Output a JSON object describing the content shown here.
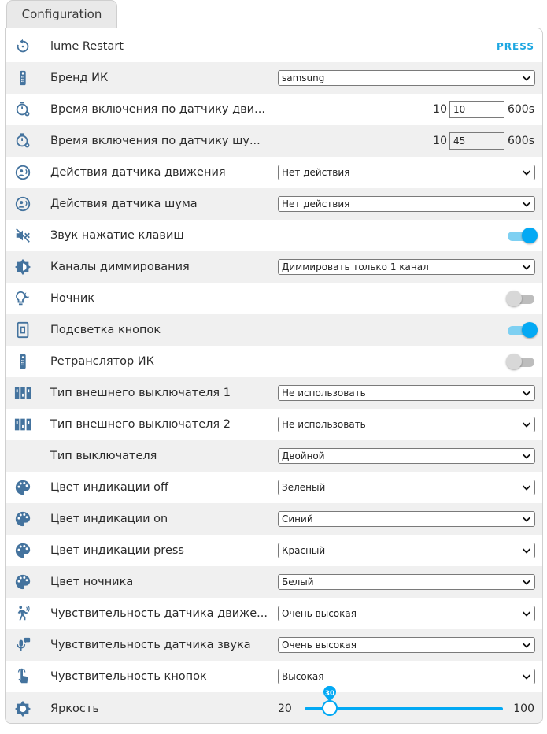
{
  "tab": {
    "label": "Configuration"
  },
  "colors": {
    "accent": "#03a9f4",
    "icon": "#44739e",
    "stripe": "#f0f0f0"
  },
  "rows": [
    {
      "icon": "restart-icon",
      "label": "lume Restart",
      "control": "press",
      "action": "PRESS"
    },
    {
      "icon": "remote-icon",
      "label": "Бренд ИК",
      "control": "select",
      "value": "samsung"
    },
    {
      "icon": "timer-cog-icon",
      "label": "Время включения по датчику дви...",
      "control": "number",
      "min": "10",
      "value": "10",
      "max": "600s"
    },
    {
      "icon": "timer-cog-icon",
      "label": "Время включения по датчику шу...",
      "control": "number",
      "min": "10",
      "value": "45",
      "max": "600s"
    },
    {
      "icon": "motion-sensor-icon",
      "label": "Действия датчика движения",
      "control": "select",
      "value": "Нет действия"
    },
    {
      "icon": "motion-sensor-icon",
      "label": "Действия датчика шума",
      "control": "select",
      "value": "Нет действия"
    },
    {
      "icon": "volume-off-icon",
      "label": "Звук нажатие клавиш",
      "control": "toggle",
      "on": true
    },
    {
      "icon": "brightness-icon",
      "label": "Каналы диммирования",
      "control": "select",
      "value": "Диммировать только 1 канал"
    },
    {
      "icon": "night-light-icon",
      "label": "Ночник",
      "control": "toggle",
      "on": false
    },
    {
      "icon": "light-switch-icon",
      "label": "Подсветка кнопок",
      "control": "toggle",
      "on": true
    },
    {
      "icon": "remote-icon",
      "label": "Ретранслятор ИК",
      "control": "toggle",
      "on": false
    },
    {
      "icon": "switch-panel-icon",
      "label": "Тип внешнего выключателя 1",
      "control": "select",
      "value": "Не использовать"
    },
    {
      "icon": "switch-panel-icon",
      "label": "Тип внешнего выключателя 2",
      "control": "select",
      "value": "Не использовать"
    },
    {
      "icon": "",
      "label": "Тип выключателя",
      "control": "select",
      "value": "Двойной"
    },
    {
      "icon": "palette-icon",
      "label": "Цвет индикации off",
      "control": "select",
      "value": "Зеленый"
    },
    {
      "icon": "palette-icon",
      "label": "Цвет индикации on",
      "control": "select",
      "value": "Синий"
    },
    {
      "icon": "palette-icon",
      "label": "Цвет индикации press",
      "control": "select",
      "value": "Красный"
    },
    {
      "icon": "palette-icon",
      "label": "Цвет ночника",
      "control": "select",
      "value": "Белый"
    },
    {
      "icon": "motion-walk-icon",
      "label": "Чувствительность датчика движе...",
      "control": "select",
      "value": "Очень высокая"
    },
    {
      "icon": "microphone-icon",
      "label": "Чувствительность датчика звука",
      "control": "select",
      "value": "Очень высокая"
    },
    {
      "icon": "touch-icon",
      "label": "Чувствительность кнопок",
      "control": "select",
      "value": "Высокая"
    },
    {
      "icon": "brightness-outline-icon",
      "label": "Яркость",
      "control": "slider",
      "min": "20",
      "value": "30",
      "max": "100"
    }
  ]
}
